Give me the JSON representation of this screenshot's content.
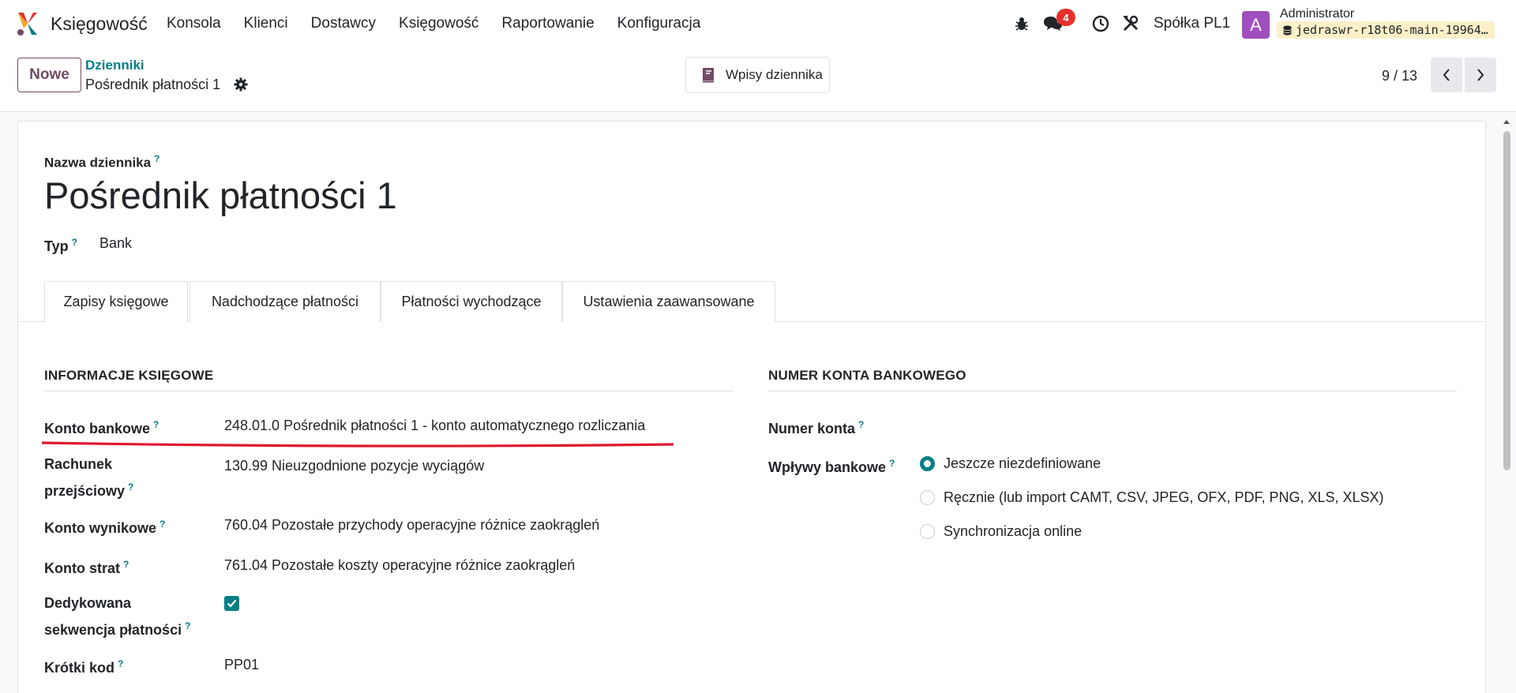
{
  "navbar": {
    "app_name": "Księgowość",
    "menu": [
      "Konsola",
      "Klienci",
      "Dostawcy",
      "Księgowość",
      "Raportowanie",
      "Konfiguracja"
    ],
    "messages_badge": "4",
    "company": "Spółka PL1",
    "avatar_letter": "A",
    "user_name": "Administrator",
    "database": "jedraswr-r18t06-main-19964…"
  },
  "control": {
    "new_label": "Nowe",
    "breadcrumb_parent": "Dzienniki",
    "breadcrumb_current": "Pośrednik płatności 1",
    "entries_button": "Wpisy dziennika",
    "pager": "9 / 13"
  },
  "form": {
    "name_label": "Nazwa dziennika",
    "name_value": "Pośrednik płatności 1",
    "type_label": "Typ",
    "type_value": "Bank",
    "tabs": [
      "Zapisy księgowe",
      "Nadchodzące płatności",
      "Płatności wychodzące",
      "Ustawienia zaawansowane"
    ],
    "left_section": {
      "title": "INFORMACJE KSIĘGOWE",
      "fields": [
        {
          "label": "Konto bankowe",
          "value": "248.01.0 Pośrednik płatności 1 - konto automatycznego rozliczania"
        },
        {
          "label_line1": "Rachunek",
          "label_line2": "przejściowy",
          "value": "130.99 Nieuzgodnione pozycje wyciągów"
        },
        {
          "label": "Konto wynikowe",
          "value": "760.04 Pozostałe przychody operacyjne różnice zaokrągleń"
        },
        {
          "label": "Konto strat",
          "value": "761.04 Pozostałe koszty operacyjne różnice zaokrągleń"
        },
        {
          "label_line1": "Dedykowana",
          "label_line2": "sekwencja płatności",
          "checked": true
        },
        {
          "label": "Krótki kod",
          "value": "PP01"
        }
      ]
    },
    "right_section": {
      "title": "NUMER KONTA BANKOWEGO",
      "account_label": "Numer konta",
      "feeds_label": "Wpływy bankowe",
      "feeds_options": [
        {
          "label": "Jeszcze niezdefiniowane",
          "checked": true
        },
        {
          "label": "Ręcznie (lub import CAMT, CSV, JPEG, OFX, PDF, PNG, XLS, XLSX)",
          "checked": false
        },
        {
          "label": "Synchronizacja online",
          "checked": false
        }
      ]
    }
  },
  "colors": {
    "brand": "#714b67",
    "accent": "#017e84",
    "badge": "#e4312b",
    "annotation": "#e0182d"
  }
}
